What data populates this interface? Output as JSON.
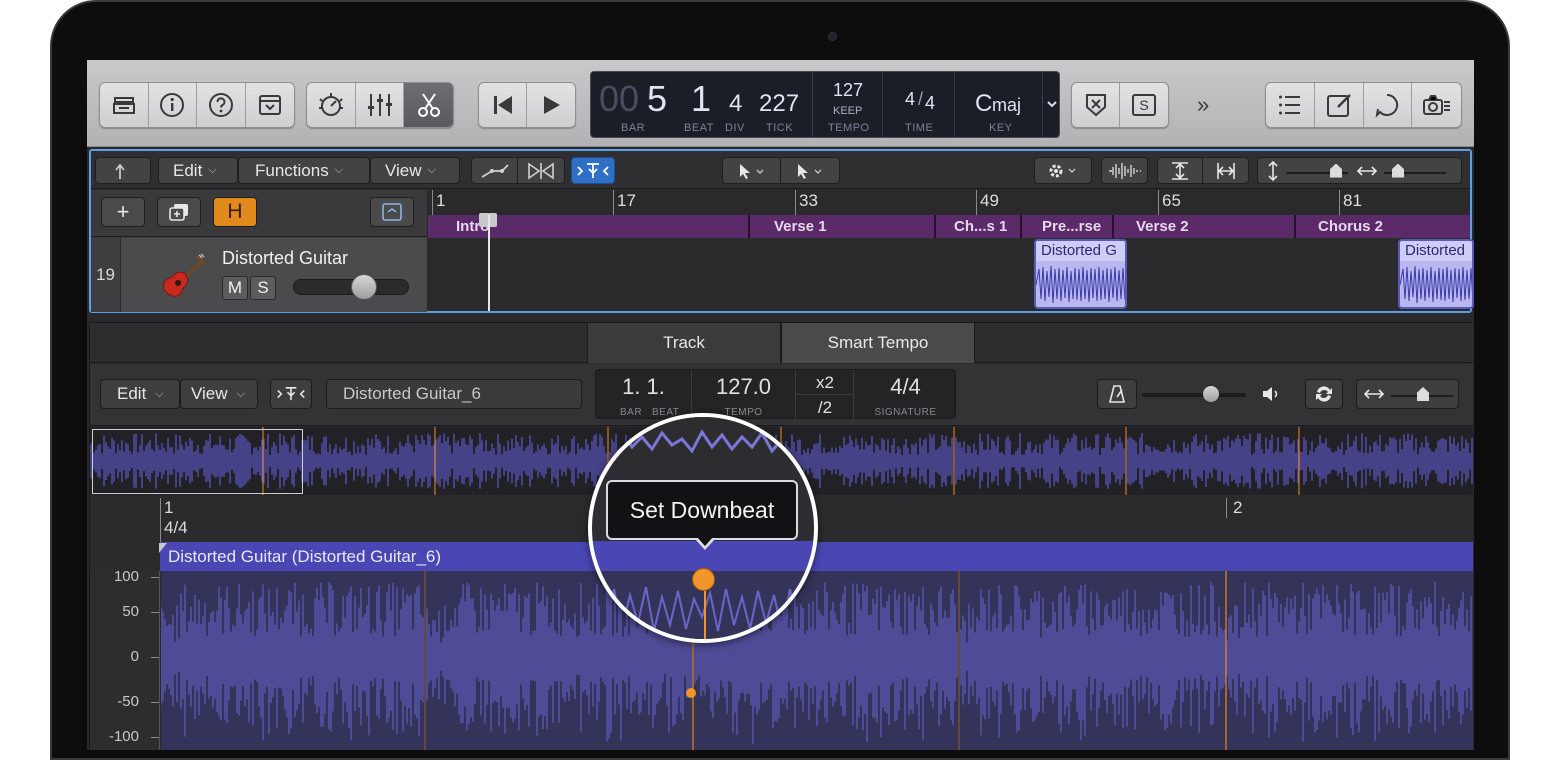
{
  "control_bar": {
    "left_buttons": [
      "library-icon",
      "info-icon",
      "help-icon",
      "toolbar-icon"
    ],
    "mid_buttons": [
      "smart-controls-icon",
      "mixer-icon",
      "editors-icon"
    ],
    "lcd": {
      "bar_dim": "00",
      "bar": "5",
      "beat": "1",
      "div": "4",
      "tick": "227",
      "bar_label": "BAR",
      "beat_label": "BEAT",
      "div_label": "DIV",
      "tick_label": "TICK",
      "tempo": "127",
      "tempo_mode": "KEEP",
      "tempo_label": "TEMPO",
      "time_num": "4",
      "time_den": "4",
      "time_label": "TIME",
      "key_root": "C",
      "key_mode": "maj",
      "key_label": "KEY"
    },
    "solo_label": "S",
    "more_label": "»"
  },
  "tracks_window": {
    "menu_edit": "Edit",
    "menu_functions": "Functions",
    "menu_view": "View",
    "ruler_ticks": [
      "1",
      "17",
      "33",
      "49",
      "65",
      "81"
    ],
    "arranger": [
      "Intro",
      "Verse 1",
      "Ch...s 1",
      "Pre...rse",
      "Verse 2",
      "Chorus 2"
    ],
    "track": {
      "number": "19",
      "name": "Distorted Guitar",
      "mute": "M",
      "solo": "S",
      "h_label": "H"
    },
    "regions": [
      "Distorted G",
      "Distorted"
    ]
  },
  "editor": {
    "tab_track": "Track",
    "tab_smart_tempo": "Smart Tempo",
    "menu_edit": "Edit",
    "menu_view": "View",
    "file_name": "Distorted Guitar_6",
    "position_value": "1. 1.",
    "position_bar_label": "BAR",
    "position_beat_label": "BEAT",
    "tempo_value": "127.0",
    "tempo_label": "TEMPO",
    "x2_label": "x2",
    "half_label": "/2",
    "signature_value": "4/4",
    "signature_label": "SIGNATURE",
    "ruler_bar1": "1",
    "ruler_sig": "4/4",
    "ruler_bar2": "2",
    "region_name": "Distorted Guitar (Distorted Guitar_6)",
    "y_axis": [
      "100",
      "50",
      "0",
      "-50",
      "-100"
    ]
  },
  "tooltip": {
    "text": "Set Downbeat"
  },
  "colors": {
    "accent_blue": "#2f6fc4",
    "beat_marker": "#f0962a",
    "region_purple": "#4a46b4",
    "arranger_purple": "#5b2a68"
  }
}
